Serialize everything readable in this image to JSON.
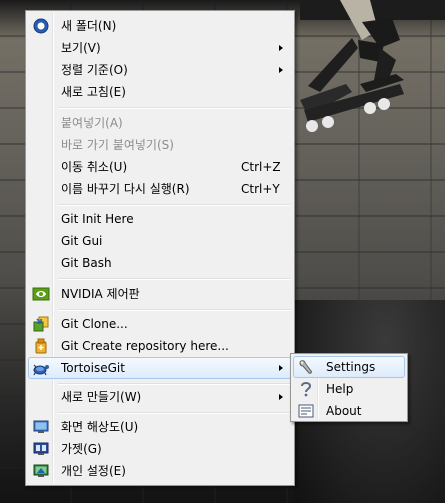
{
  "context_menu": {
    "items": [
      {
        "label": "새 폴더(N)",
        "icon": "new-folder-icon"
      },
      {
        "label": "보기(V)",
        "submenu": true
      },
      {
        "label": "정렬 기준(O)",
        "submenu": true
      },
      {
        "label": "새로 고침(E)"
      },
      {
        "label": "붙여넣기(A)",
        "disabled": true
      },
      {
        "label": "바로 가기 붙여넣기(S)",
        "disabled": true
      },
      {
        "label": "이동 취소(U)",
        "shortcut": "Ctrl+Z"
      },
      {
        "label": "이름 바꾸기 다시 실행(R)",
        "shortcut": "Ctrl+Y"
      },
      {
        "label": "Git Init Here"
      },
      {
        "label": "Git Gui"
      },
      {
        "label": "Git Bash"
      },
      {
        "label": "NVIDIA 제어판",
        "icon": "nvidia-icon"
      },
      {
        "label": "Git Clone...",
        "icon": "git-clone-icon"
      },
      {
        "label": "Git Create repository here...",
        "icon": "git-create-repo-icon"
      },
      {
        "label": "TortoiseGit",
        "icon": "tortoisegit-icon",
        "submenu": true,
        "highlighted": true
      },
      {
        "label": "새로 만들기(W)",
        "submenu": true
      },
      {
        "label": "화면 해상도(U)",
        "icon": "screen-resolution-icon"
      },
      {
        "label": "가젯(G)",
        "icon": "gadgets-icon"
      },
      {
        "label": "개인 설정(E)",
        "icon": "personalize-icon"
      }
    ]
  },
  "tortoisegit_submenu": {
    "items": [
      {
        "label": "Settings",
        "icon": "settings-wrench-icon",
        "highlighted": true
      },
      {
        "label": "Help",
        "icon": "help-icon"
      },
      {
        "label": "About",
        "icon": "about-icon"
      }
    ]
  },
  "colors": {
    "menu_background": "#f0f0f0",
    "menu_border": "#979797",
    "highlight_border": "#a8c8ec",
    "disabled_text": "#8d8d8d"
  }
}
